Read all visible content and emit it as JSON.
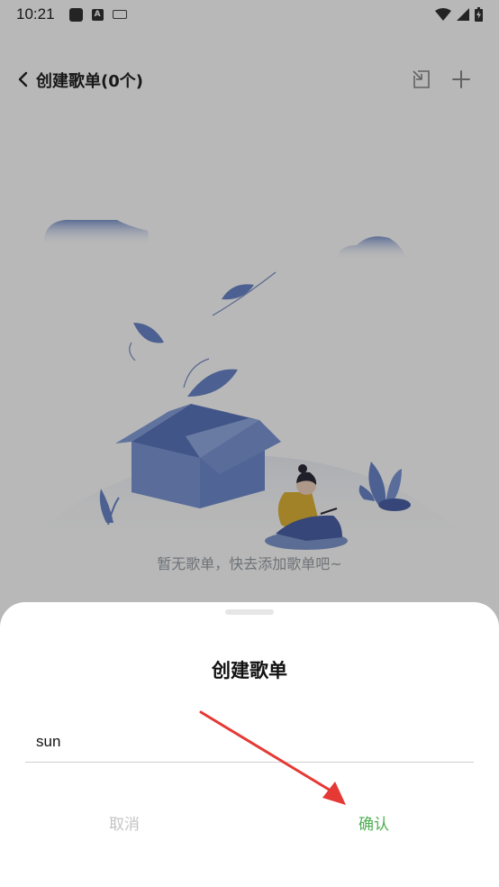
{
  "status_bar": {
    "time": "10:21",
    "a_glyph": "A"
  },
  "header": {
    "title": "创建歌单(0个)"
  },
  "empty_state": {
    "message": "暂无歌单，快去添加歌单吧~"
  },
  "dialog": {
    "title": "创建歌单",
    "input_value": "sun",
    "cancel_label": "取消",
    "confirm_label": "确认"
  },
  "colors": {
    "accent": "#4caf50",
    "annotation": "#e53935",
    "illustration_blue": "#6a86c9"
  }
}
